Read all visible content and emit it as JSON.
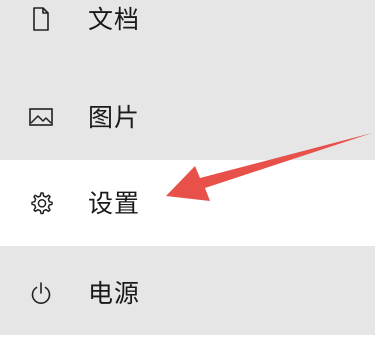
{
  "menu": {
    "items": [
      {
        "label": "文档",
        "icon": "document-icon"
      },
      {
        "label": "图片",
        "icon": "picture-icon"
      },
      {
        "label": "设置",
        "icon": "gear-icon"
      },
      {
        "label": "电源",
        "icon": "power-icon"
      }
    ]
  },
  "colors": {
    "menu_background": "#e6e6e6",
    "highlight_background": "#ffffff",
    "annotation_arrow": "#e8504a"
  }
}
